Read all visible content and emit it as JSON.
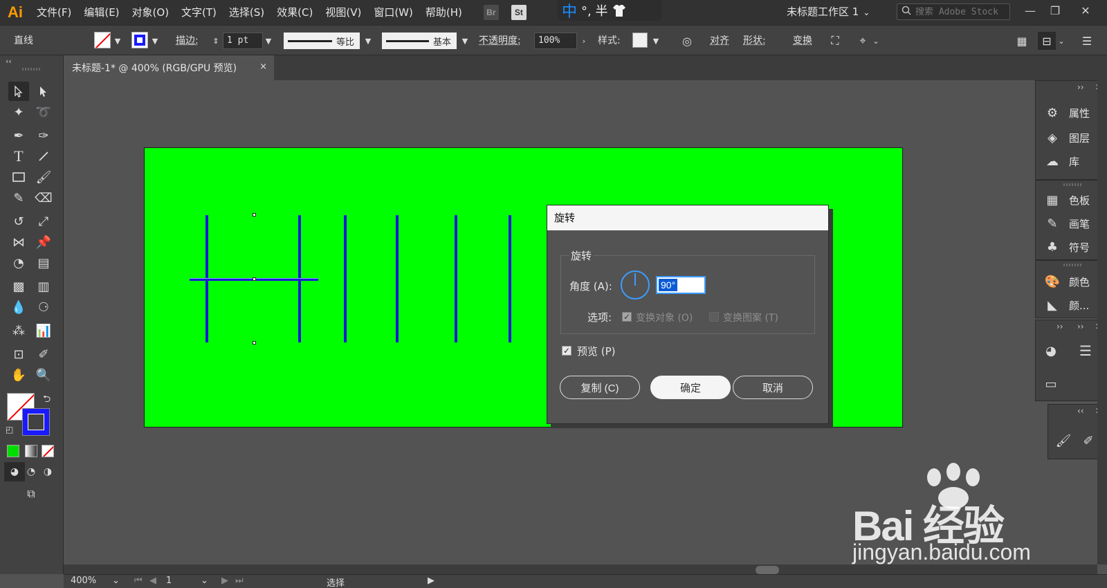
{
  "menubar": {
    "logo": "Ai",
    "items": [
      "文件(F)",
      "编辑(E)",
      "对象(O)",
      "文字(T)",
      "选择(S)",
      "效果(C)",
      "视图(V)",
      "窗口(W)",
      "帮助(H)"
    ],
    "app_icons": [
      "Br",
      "St"
    ],
    "ime": {
      "lang": "中",
      "text": "°, 半"
    },
    "workspace": "未标题工作区 1",
    "search_placeholder": "搜索 Adobe Stock"
  },
  "controlbar": {
    "selection_type": "直线",
    "stroke_label": "描边:",
    "stroke_weight": "1 pt",
    "profile_label": "等比",
    "brush_label": "基本",
    "opacity_label": "不透明度:",
    "opacity_value": "100%",
    "style_label": "样式:",
    "align_label": "对齐",
    "shape_label": "形状:",
    "transform_label": "变换"
  },
  "document_tab": {
    "title": "未标题-1* @ 400% (RGB/GPU 预览)",
    "close": "×"
  },
  "artboard_color": "#00ff00",
  "stroke_color": "#1a1ad6",
  "rotate_dialog": {
    "title": "旋转",
    "group_label": "旋转",
    "angle_label": "角度 (A):",
    "angle_value": "90°",
    "options_label": "选项:",
    "transform_objects": "变换对象 (O)",
    "transform_patterns": "变换图案 (T)",
    "preview_label": "预览 (P)",
    "preview_checked": true,
    "copy_button": "复制 (C)",
    "ok_button": "确定",
    "cancel_button": "取消"
  },
  "right_panels": {
    "group1": [
      "属性",
      "图层",
      "库"
    ],
    "group2": [
      "色板",
      "画笔",
      "符号"
    ],
    "group3": [
      "颜色",
      "颜..."
    ]
  },
  "statusbar": {
    "zoom": "400%",
    "page": "1",
    "tool": "选择"
  },
  "watermark": {
    "brand": "Bai 经验",
    "url": "jingyan.baidu.com"
  }
}
